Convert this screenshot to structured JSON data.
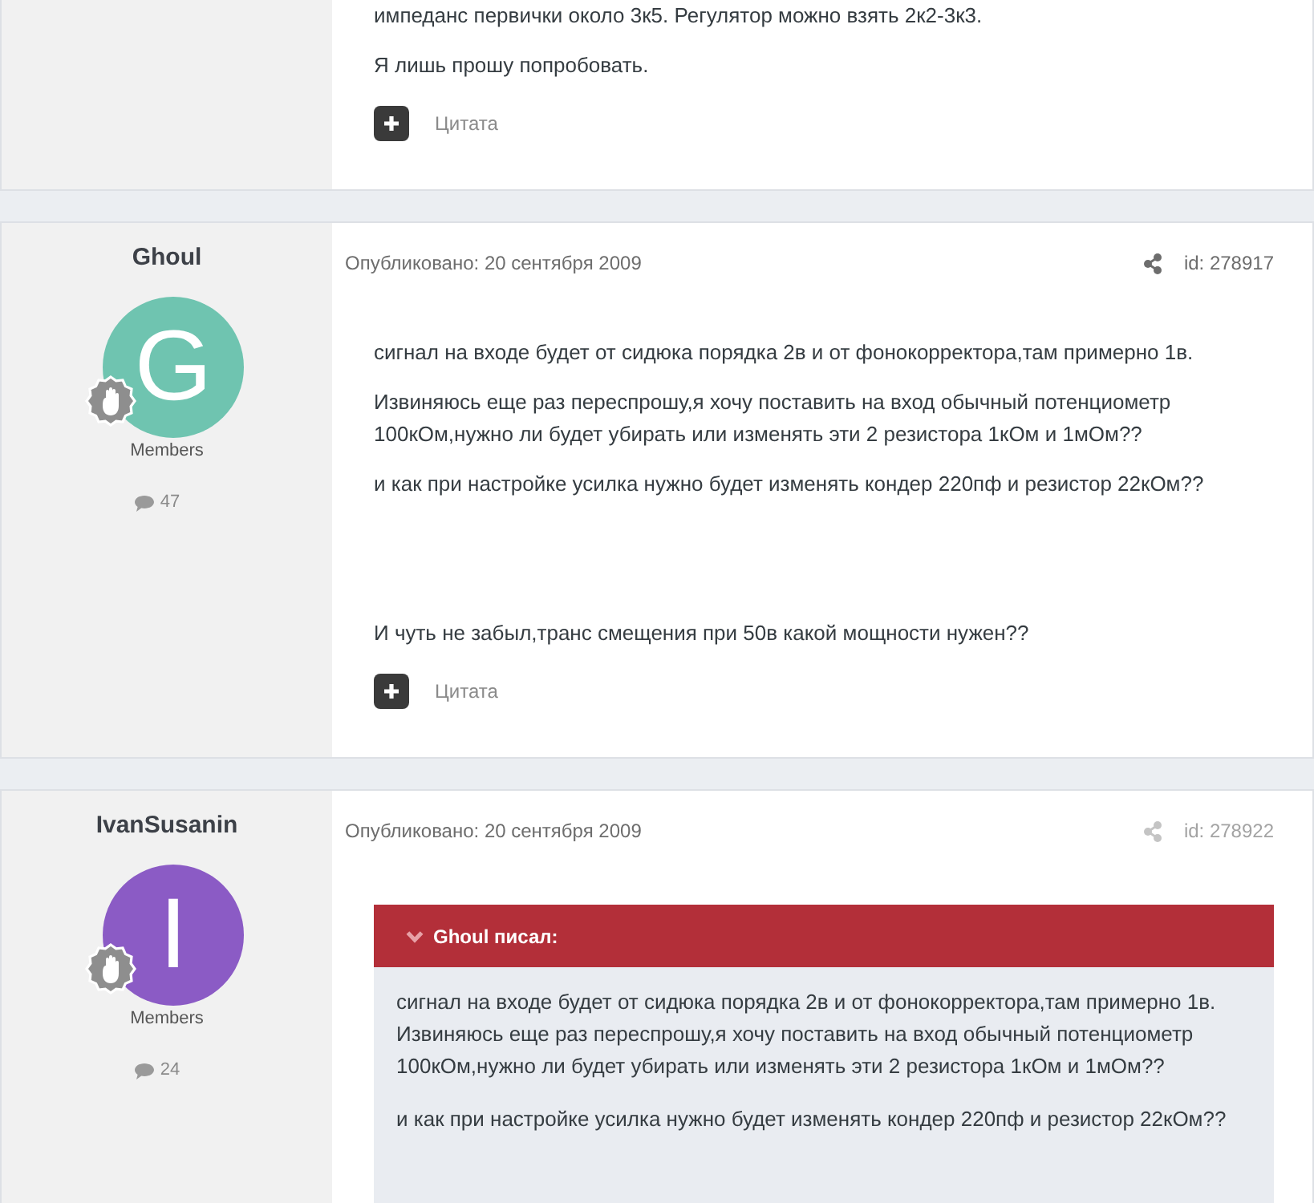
{
  "posts": [
    {
      "body": [
        {
          "kind": "text",
          "text": "импеданс первички около 3к5. Регулятор можно взять 2к2-3к3."
        },
        {
          "kind": "text",
          "text": "Я лишь прошу попробовать."
        }
      ],
      "quote_link": "Цитата"
    },
    {
      "author": {
        "name": "Ghoul",
        "initial": "G",
        "color": "#6fc4b0",
        "group": "Members",
        "post_count": "47"
      },
      "header": {
        "published": "Опубликовано: 20 сентября 2009",
        "id": "id: 278917",
        "dimmed": false
      },
      "body": [
        {
          "kind": "text",
          "text": "сигнал на входе будет от сидюка порядка 2в и от фонокорректора,там примерно 1в."
        },
        {
          "kind": "text",
          "text": "Извиняюсь еще раз переспрошу,я хочу поставить на вход обычный потенциометр 100кОм,нужно ли будет убирать или изменять эти 2 резистора 1кОм и 1мОм??"
        },
        {
          "kind": "text",
          "text": "и как при настройке усилка нужно будет изменять кондер 220пф и резистор 22кОм??"
        },
        {
          "kind": "break"
        },
        {
          "kind": "break"
        },
        {
          "kind": "text",
          "text": "И чуть не забыл,транс смещения при 50в какой мощности нужен??"
        }
      ],
      "quote_link": "Цитата"
    },
    {
      "author": {
        "name": "IvanSusanin",
        "initial": "I",
        "color": "#8b5bc5",
        "group": "Members",
        "post_count": "24"
      },
      "header": {
        "published": "Опубликовано: 20 сентября 2009",
        "id": "id: 278922",
        "dimmed": true
      },
      "body": [
        {
          "kind": "quote",
          "cite": "Ghoul писал:",
          "paragraphs": [
            "сигнал на входе будет от сидюка порядка 2в и от фонокорректора,там примерно 1в.\nИзвиняюсь еще раз переспрошу,я хочу поставить на вход обычный потенциометр 100кОм,нужно ли будет убирать или изменять эти 2 резистора 1кОм и 1мОм??",
            "и как при настройке усилка нужно будет изменять кондер 220пф и резистор 22кОм??"
          ]
        }
      ]
    }
  ]
}
